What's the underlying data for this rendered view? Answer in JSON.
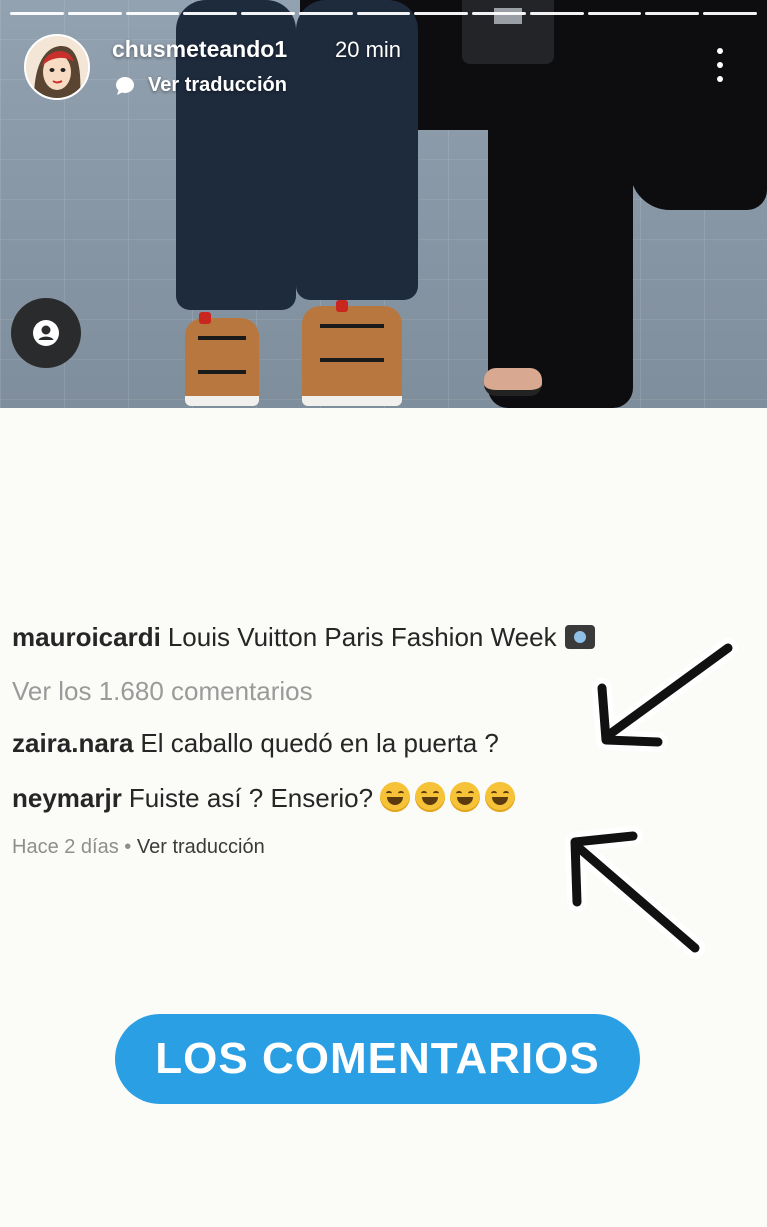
{
  "story": {
    "username": "chusmeteando1",
    "time": "20 min",
    "translate_label": "Ver traducción",
    "progress_segments": 13
  },
  "post": {
    "caption": {
      "user": "mauroicardi",
      "text": "Louis Vuitton Paris Fashion Week"
    },
    "view_all": "Ver los 1.680 comentarios",
    "comments": [
      {
        "user": "zaira.nara",
        "text": "El caballo quedó en la puerta ?"
      },
      {
        "user": "neymarjr",
        "text": "Fuiste así ? Enserio?"
      }
    ],
    "time_ago": "Hace 2 días",
    "separator": "•",
    "translate_label": "Ver traducción"
  },
  "cta": {
    "label": "LOS COMENTARIOS",
    "color": "#2a9fe4"
  },
  "icons": {
    "more": "more-vertical-icon",
    "profile": "profile-icon",
    "translate": "chat-bubble-icon",
    "emoji": "grinning-squinting-face-icon",
    "camera": "camera-flash-icon",
    "arrows": "arrow-icon"
  }
}
